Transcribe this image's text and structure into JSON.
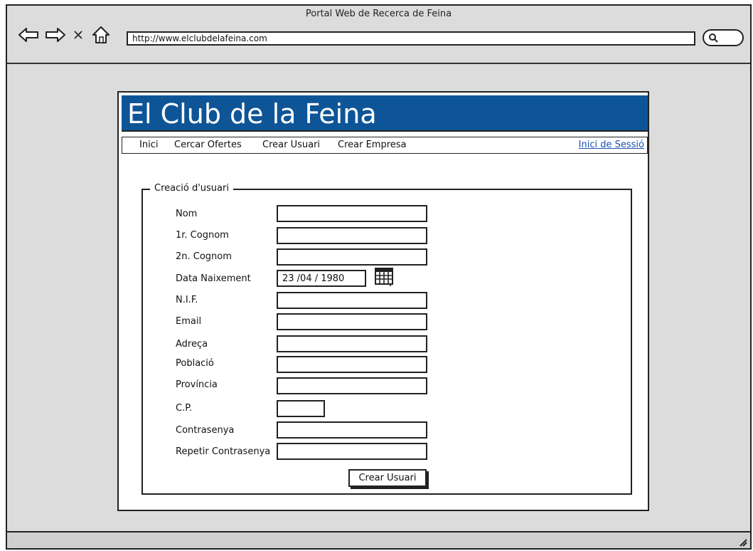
{
  "window": {
    "title": "Portal Web de Recerca de Feina"
  },
  "browser": {
    "url": "http://www.elclubdelafeina.com",
    "icons": [
      "back-arrow-icon",
      "forward-arrow-icon",
      "close-icon",
      "home-icon",
      "search-icon"
    ]
  },
  "site": {
    "banner_title": "El Club de la Feina"
  },
  "menu": {
    "items": [
      "Inici",
      "Cercar Ofertes",
      "Crear Usuari",
      "Crear Empresa"
    ],
    "login": "Inici de Sessió"
  },
  "form": {
    "legend": "Creació d'usuari",
    "fields": [
      {
        "label": "Nom",
        "value": ""
      },
      {
        "label": "1r. Cognom",
        "value": ""
      },
      {
        "label": "2n. Cognom",
        "value": ""
      },
      {
        "label": "Data Naixement",
        "value": "23 /04 / 1980"
      },
      {
        "label": "N.I.F.",
        "value": ""
      },
      {
        "label": "Email",
        "value": ""
      },
      {
        "label": "Adreça",
        "value": ""
      },
      {
        "label": "Població",
        "value": ""
      },
      {
        "label": "Província",
        "value": ""
      },
      {
        "label": "C.P.",
        "value": ""
      },
      {
        "label": "Contrasenya",
        "value": ""
      },
      {
        "label": "Repetir Contrasenya",
        "value": ""
      }
    ],
    "submit_label": "Crear Usuari"
  },
  "colors": {
    "banner": "#0e5597",
    "link": "#1a4fb0"
  }
}
